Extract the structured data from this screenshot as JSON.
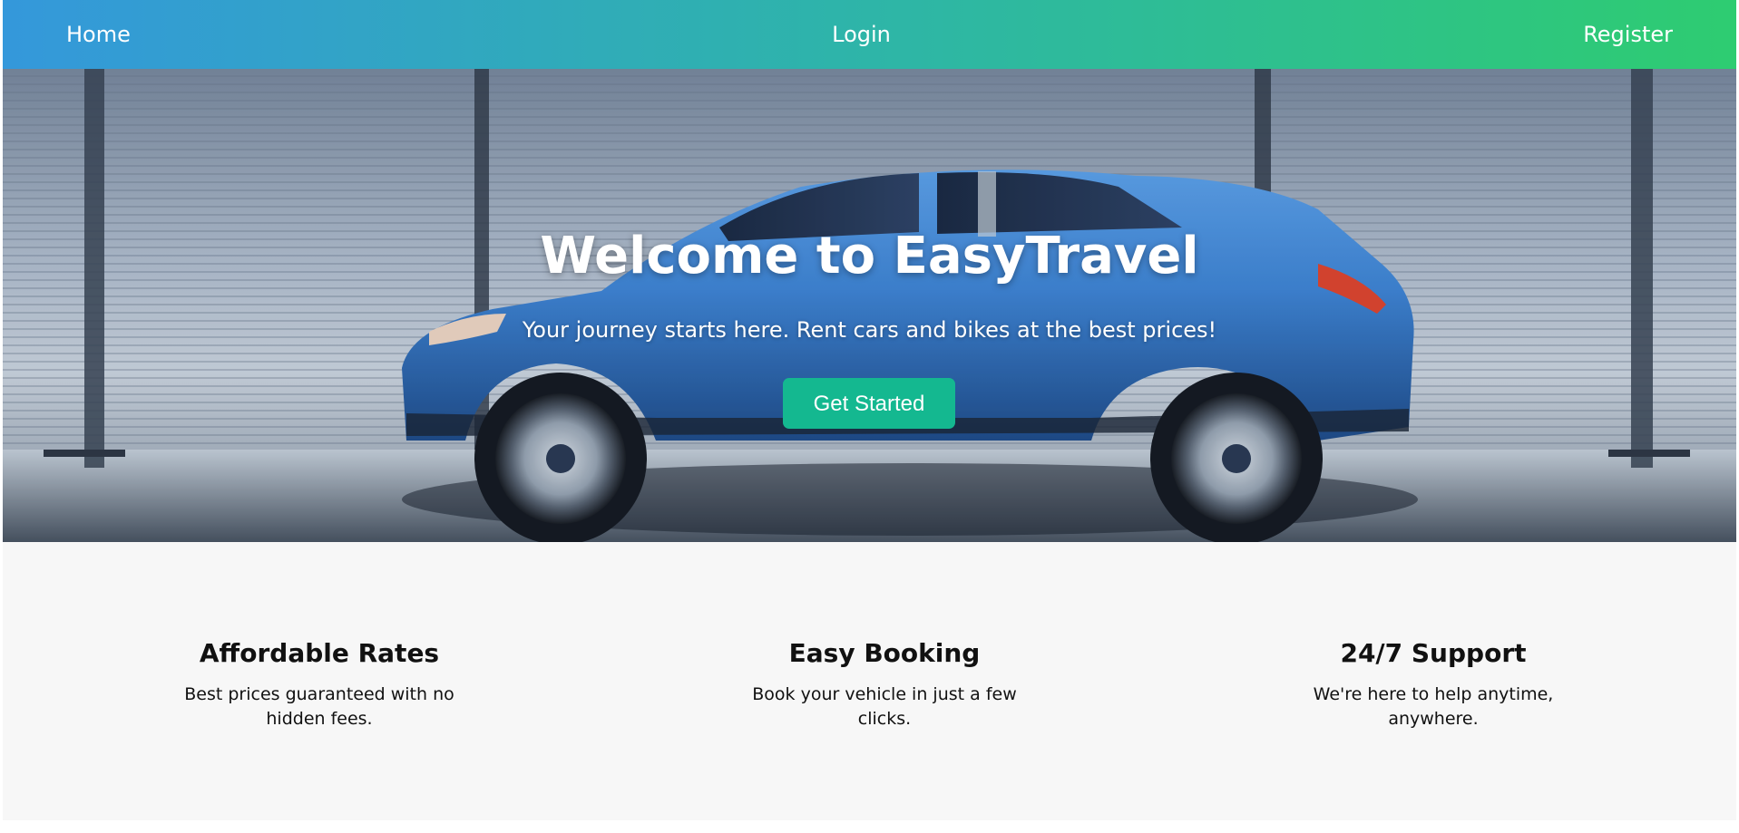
{
  "nav": {
    "home": "Home",
    "login": "Login",
    "register": "Register"
  },
  "hero": {
    "title": "Welcome to EasyTravel",
    "subtitle": "Your journey starts here. Rent cars and bikes at the best prices!",
    "cta_label": "Get Started",
    "image": "blue-suv-car-image"
  },
  "features": [
    {
      "title": "Affordable Rates",
      "text": "Best prices guaranteed with no hidden fees."
    },
    {
      "title": "Easy Booking",
      "text": "Book your vehicle in just a few clicks."
    },
    {
      "title": "24/7 Support",
      "text": "We're here to help anytime, anywhere."
    }
  ],
  "colors": {
    "nav_gradient_start": "#3498db",
    "nav_gradient_end": "#2ecc71",
    "cta": "#14b890",
    "car_body": "#3f86d8",
    "features_bg": "#f7f7f7"
  }
}
